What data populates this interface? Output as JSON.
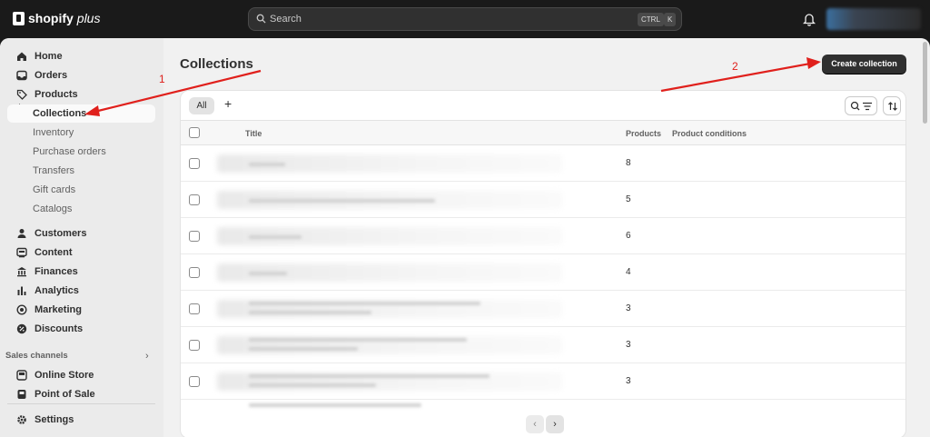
{
  "topbar": {
    "brand": "shopify",
    "brand_suffix": "plus",
    "search_placeholder": "Search",
    "kbd_ctrl": "CTRL",
    "kbd_k": "K"
  },
  "sidebar": {
    "items": [
      {
        "label": "Home",
        "icon": "home-icon"
      },
      {
        "label": "Orders",
        "icon": "inbox-icon"
      },
      {
        "label": "Products",
        "icon": "tag-icon"
      },
      {
        "label": "Collections"
      },
      {
        "label": "Inventory"
      },
      {
        "label": "Purchase orders"
      },
      {
        "label": "Transfers"
      },
      {
        "label": "Gift cards"
      },
      {
        "label": "Catalogs"
      },
      {
        "label": "Customers",
        "icon": "person-icon"
      },
      {
        "label": "Content",
        "icon": "content-icon"
      },
      {
        "label": "Finances",
        "icon": "bank-icon"
      },
      {
        "label": "Analytics",
        "icon": "bar-chart-icon"
      },
      {
        "label": "Marketing",
        "icon": "target-icon"
      },
      {
        "label": "Discounts",
        "icon": "discount-icon"
      }
    ],
    "sales_channels_label": "Sales channels",
    "channels": [
      {
        "label": "Online Store",
        "icon": "store-icon"
      },
      {
        "label": "Point of Sale",
        "icon": "pos-icon"
      }
    ],
    "settings_label": "Settings"
  },
  "main": {
    "title": "Collections",
    "create_button": "Create collection",
    "tabs": [
      {
        "label": "All"
      }
    ],
    "add_tab": "+",
    "columns": {
      "title": "Title",
      "products": "Products",
      "conditions": "Product conditions"
    },
    "rows": [
      {
        "products": "8"
      },
      {
        "products": "5"
      },
      {
        "products": "6"
      },
      {
        "products": "4"
      },
      {
        "products": "3"
      },
      {
        "products": "3"
      },
      {
        "products": "3"
      }
    ],
    "pager": {
      "prev": "‹",
      "next": "›"
    }
  },
  "annotations": {
    "a1": "1",
    "a2": "2"
  },
  "colors": {
    "arrow": "#e0201c",
    "primary_button": "#303030",
    "sidebar_bg": "#ebebeb"
  }
}
